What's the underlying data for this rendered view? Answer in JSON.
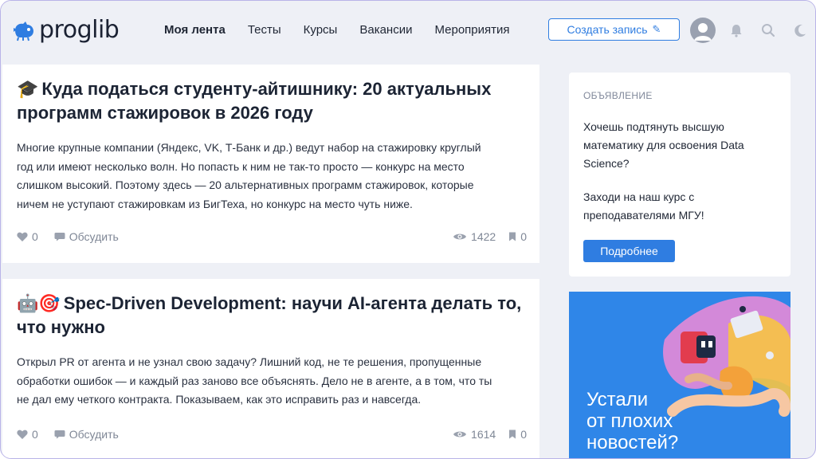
{
  "header": {
    "logo_text": "proglib",
    "nav": [
      {
        "label": "Моя лента",
        "active": true
      },
      {
        "label": "Тесты",
        "active": false
      },
      {
        "label": "Курсы",
        "active": false
      },
      {
        "label": "Вакансии",
        "active": false
      },
      {
        "label": "Мероприятия",
        "active": false
      }
    ],
    "create_label": "Создать запись",
    "icons": [
      "user-avatar-icon",
      "bell-icon",
      "search-icon",
      "moon-icon"
    ]
  },
  "posts": [
    {
      "emoji": "🎓",
      "title": "Куда податься студенту-айтишнику: 20 актуальных программ стажировок в 2026 году",
      "body_lines": [
        "Многие крупные компании (Яндекс, VK, Т-Банк и др.) ведут набор на стажировку круглый",
        "год или имеют несколько волн. Но попасть к ним не так-то просто — конкурс на место",
        "слишком высокий. Поэтому здесь — 20 альтернативных программ стажировок, которые",
        "ничем не уступают стажировкам из БигТеха, но конкурс на место чуть ниже."
      ],
      "likes": "0",
      "discuss": "Обсудить",
      "views": "1422",
      "bookmarks": "0"
    },
    {
      "emoji": "🤖🎯",
      "title": "Spec-Driven Development: научи AI-агента делать то, что нужно",
      "body_lines": [
        "Открыл PR от агента и не узнал свою задачу? Лишний код, не те решения, пропущенные",
        "обработки ошибок — и каждый раз заново все объяснять. Дело не в агенте, а в том, что ты",
        "не дал ему четкого контракта. Показываем, как это исправить раз и навсегда."
      ],
      "likes": "0",
      "discuss": "Обсудить",
      "views": "1614",
      "bookmarks": "0"
    }
  ],
  "sidebar": {
    "ad_label": "ОБЪЯВЛЕНИЕ",
    "ad_text1": "Хочешь подтянуть высшую математику для освоения Data Science?",
    "ad_text2": "Заходи на наш курс с преподавателями МГУ!",
    "ad_button": "Подробнее",
    "banner_lines": [
      "Устали",
      "от плохих",
      "новостей?"
    ]
  },
  "colors": {
    "accent": "#2f7de1",
    "banner": "#2f86e8",
    "page_bg": "#eef0f6"
  }
}
